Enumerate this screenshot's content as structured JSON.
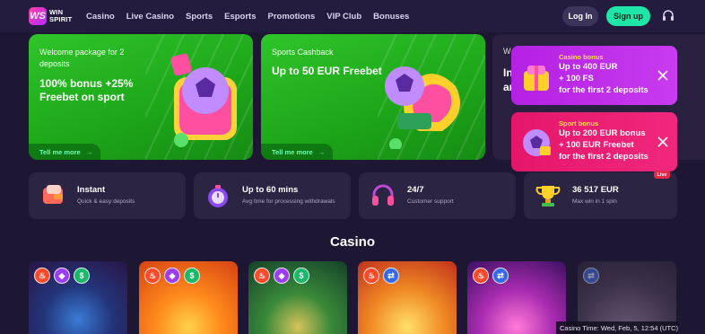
{
  "header": {
    "logo_line1": "WIN",
    "logo_line2": "SPIRIT",
    "logo_mark": "WS",
    "nav": [
      "Casino",
      "Live Casino",
      "Sports",
      "Esports",
      "Promotions",
      "VIP Club",
      "Bonuses"
    ],
    "login_label": "Log In",
    "signup_label": "Sign up",
    "support_icon": "headset-icon"
  },
  "promos": [
    {
      "small": "Welcome package for 2 deposits",
      "big": "100% bonus +25% Freebet on sport",
      "cta": "Tell me more",
      "icon": "soccer-ball-gift-icon"
    },
    {
      "small": "Sports Cashback",
      "big": "Up to 50 EUR Freebet",
      "cta": "Tell me more",
      "icon": "soccer-ball-cashback-icon"
    },
    {
      "small": "W",
      "big_a": "In",
      "big_b": "ar"
    }
  ],
  "bonuses": {
    "casino": {
      "title": "Casino bonus",
      "line1": "Up to 400 EUR",
      "line2": "+ 100 FS",
      "line3": "for the first 2 deposits"
    },
    "sport": {
      "title": "Sport bonus",
      "line1": "Up to 200 EUR bonus",
      "line2": "+ 100 EUR Freebet",
      "line3": "for the first 2 deposits"
    }
  },
  "features": [
    {
      "title": "Instant",
      "sub": "Quick & easy deposits",
      "icon": "wallet-icon"
    },
    {
      "title": "Up to 60 mins",
      "sub": "Avg time for processing withdrawals",
      "icon": "stopwatch-icon"
    },
    {
      "title": "24/7",
      "sub": "Customer support",
      "icon": "headphones-icon"
    },
    {
      "title": "36 517 EUR",
      "sub": "Max win in 1 spin",
      "icon": "trophy-icon"
    }
  ],
  "live_badge": "Live",
  "casino": {
    "title": "Casino",
    "time": "Casino Time: Wed, Feb, 5, 12:54 (UTC)"
  },
  "colors": {
    "bg": "#1d1733",
    "accent_green": "#1ee6a6",
    "promo_green": "#2fc42a",
    "casino_bonus": "#c83bf0",
    "sport_bonus": "#f0287d"
  }
}
